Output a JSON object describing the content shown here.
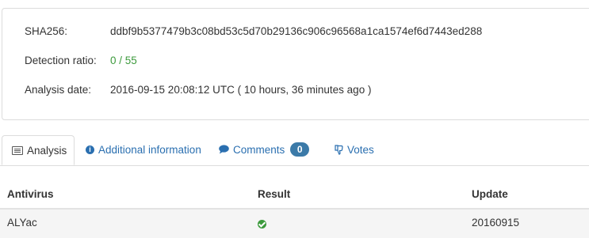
{
  "summary": {
    "sha_label": "SHA256:",
    "sha_value": "ddbf9b5377479b3c08bd53c5d70b29136c906c96568a1ca1574ef6d7443ed288",
    "ratio_label": "Detection ratio:",
    "ratio_value": "0 / 55",
    "date_label": "Analysis date:",
    "date_value": "2016-09-15 20:08:12 UTC ( 10 hours, 36 minutes ago )"
  },
  "tabs": {
    "analysis": "Analysis",
    "info": "Additional information",
    "comments": "Comments",
    "comments_count": "0",
    "votes": "Votes"
  },
  "table": {
    "headers": [
      "Antivirus",
      "Result",
      "Update"
    ],
    "rows": [
      {
        "antivirus": "ALYac",
        "result_icon": "check-circle-icon",
        "update": "20160915"
      }
    ]
  },
  "colors": {
    "clean": "#3c9a3c",
    "link": "#2a6fb0",
    "badge": "#3b7aa8"
  }
}
